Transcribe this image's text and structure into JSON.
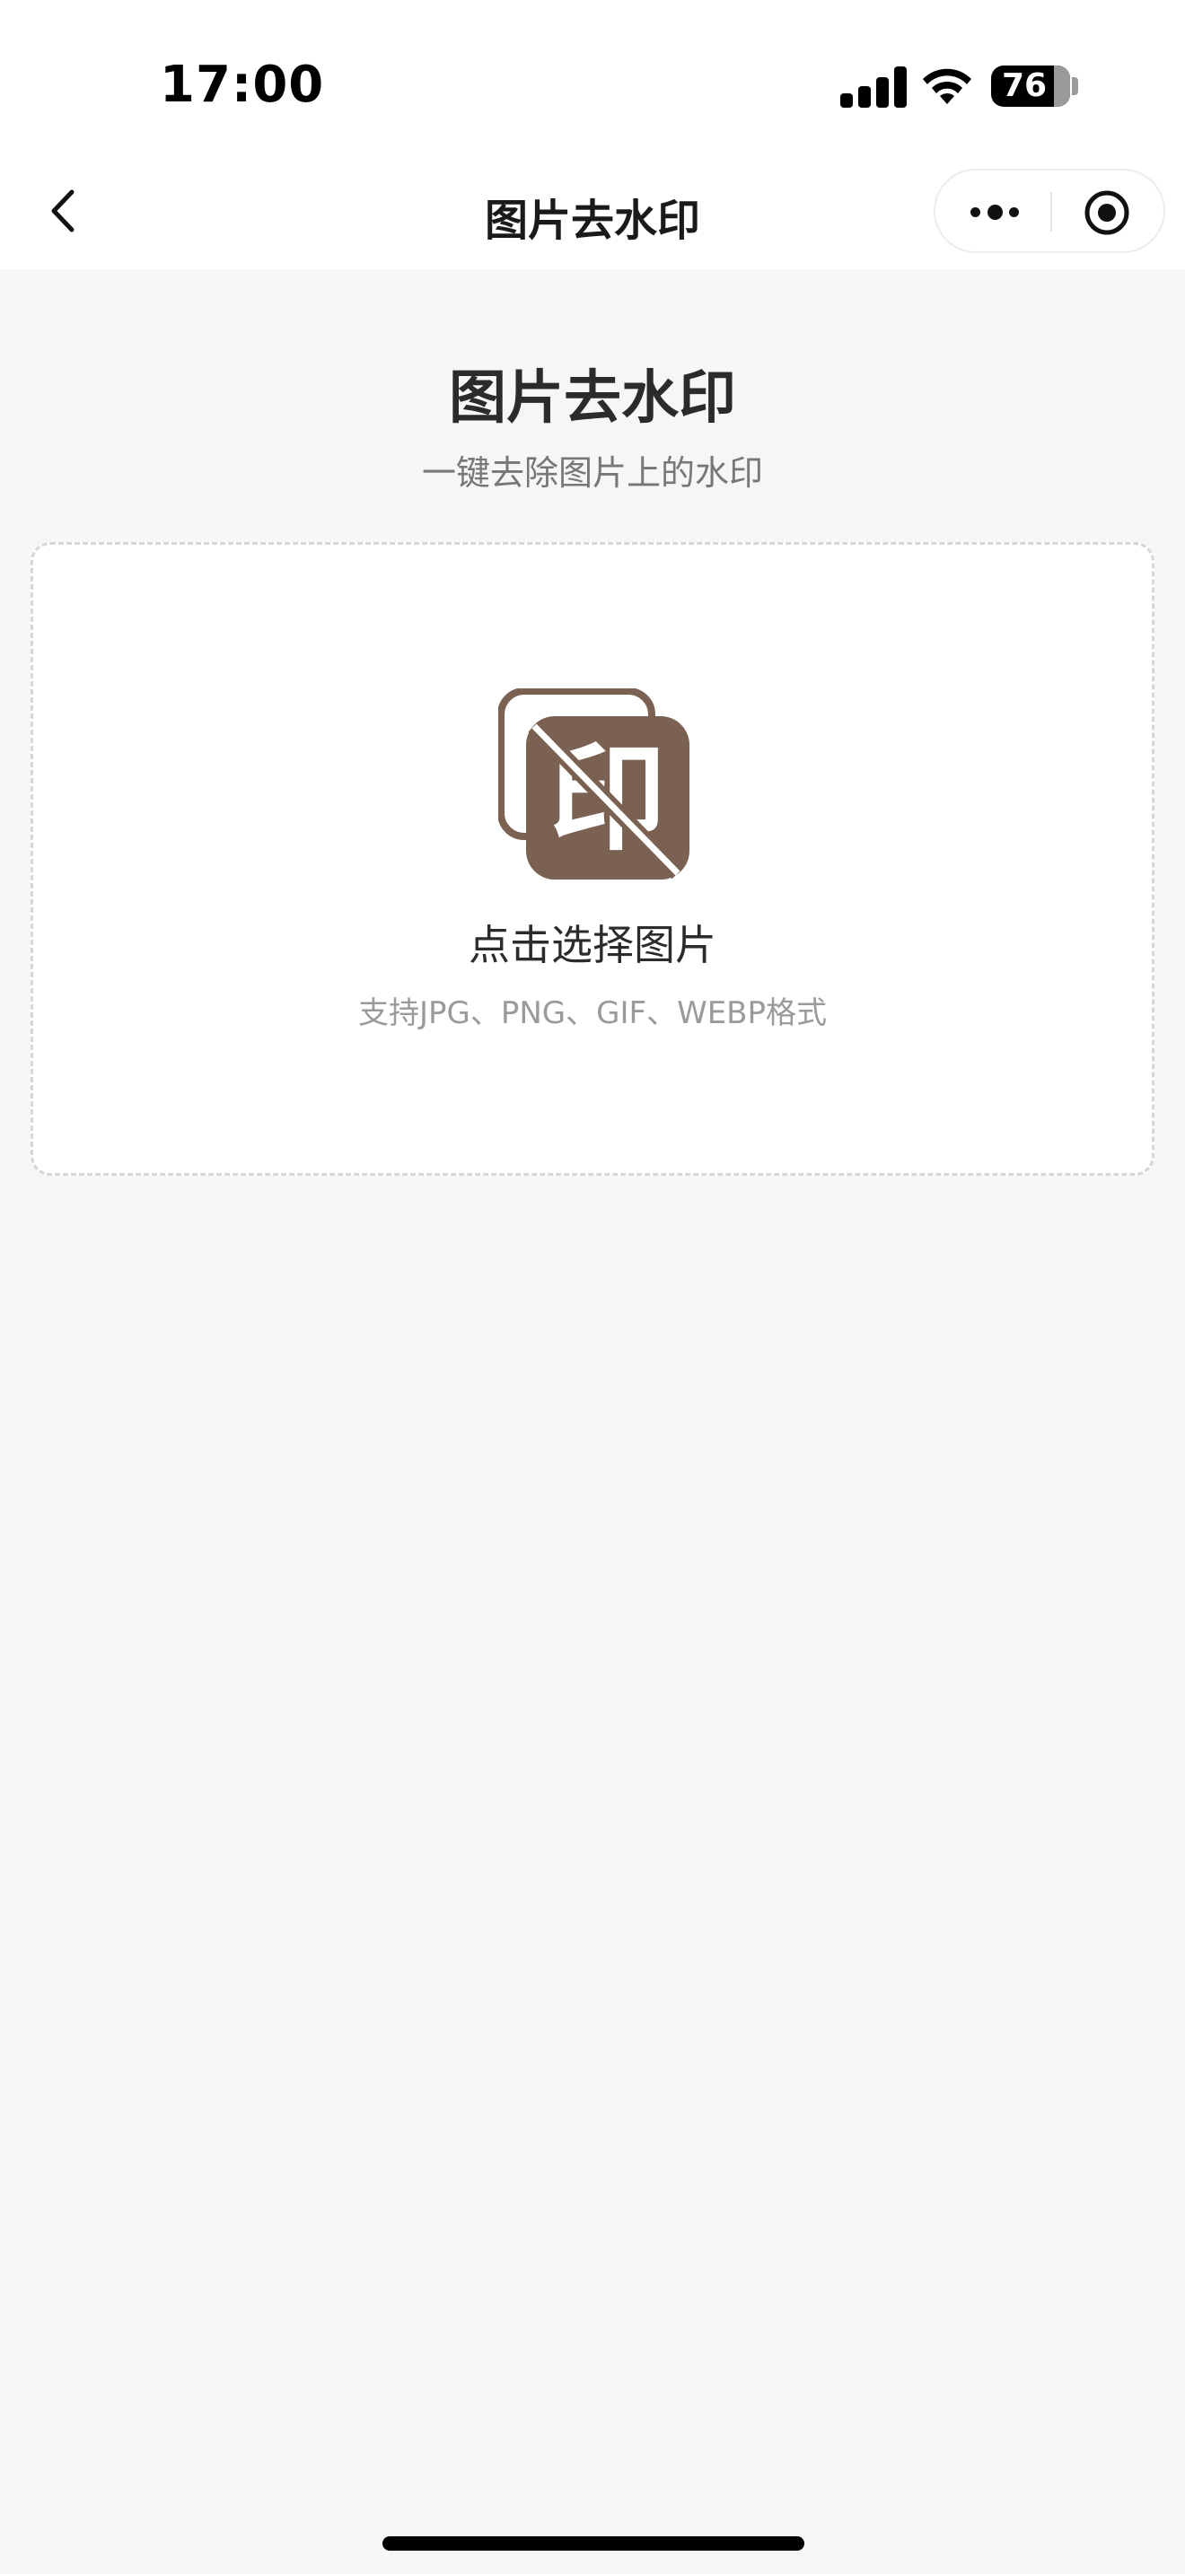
{
  "status_bar": {
    "time": "17:00",
    "battery": "76"
  },
  "nav": {
    "title": "图片去水印"
  },
  "header": {
    "title": "图片去水印",
    "subtitle": "一键去除图片上的水印"
  },
  "upload": {
    "icon_glyph": "印",
    "label": "点击选择图片",
    "hint": "支持JPG、PNG、GIF、WEBP格式"
  },
  "colors": {
    "icon_brown": "#7a6152",
    "page_bg": "#f6f6f6"
  }
}
